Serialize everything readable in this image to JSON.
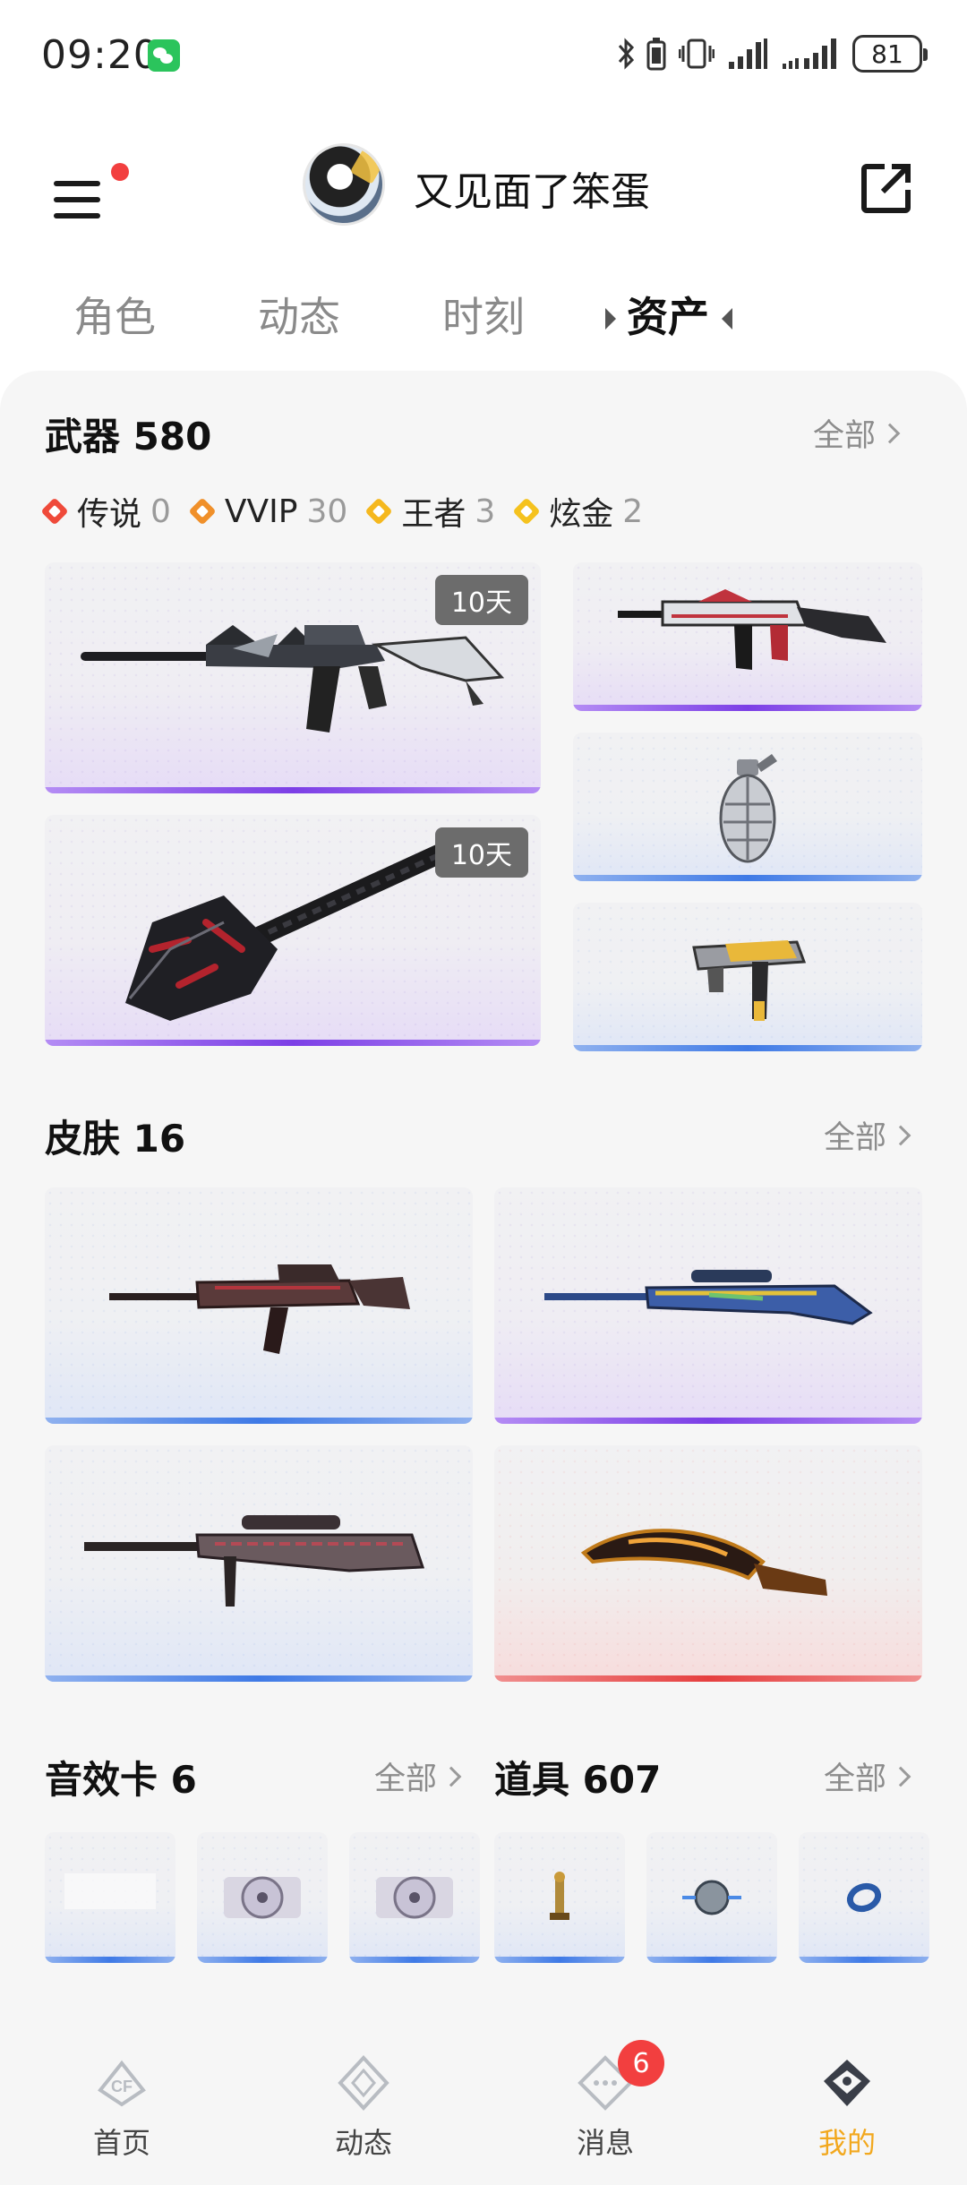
{
  "status_bar": {
    "time": "09:20",
    "battery": "81"
  },
  "header": {
    "username": "又见面了笨蛋"
  },
  "tabs": [
    {
      "label": "角色"
    },
    {
      "label": "动态"
    },
    {
      "label": "时刻"
    },
    {
      "label": "资产"
    }
  ],
  "weapons": {
    "title": "武器 580",
    "see_all": "全部",
    "rarities": [
      {
        "label": "传说",
        "count": "0",
        "color": "#ef4a3a"
      },
      {
        "label": "VVIP",
        "count": "30",
        "color": "#f0902a"
      },
      {
        "label": "王者",
        "count": "3",
        "color": "#f5b81e"
      },
      {
        "label": "炫金",
        "count": "2",
        "color": "#f5c21e"
      }
    ],
    "items": [
      {
        "name": "rifle",
        "tag": "10天",
        "rarity": "purple"
      },
      {
        "name": "shovel",
        "tag": "10天",
        "rarity": "purple"
      },
      {
        "name": "rifle-white-red",
        "rarity": "purple"
      },
      {
        "name": "grenade",
        "rarity": "blue"
      },
      {
        "name": "smg-gold",
        "rarity": "blue"
      }
    ]
  },
  "skins": {
    "title": "皮肤 16",
    "see_all": "全部",
    "items": [
      {
        "name": "rifle-red",
        "rarity": "blue"
      },
      {
        "name": "sniper-camo",
        "rarity": "purple"
      },
      {
        "name": "heavy-sniper",
        "rarity": "blue"
      },
      {
        "name": "kukri-knife",
        "rarity": "red"
      }
    ]
  },
  "sound_cards": {
    "title": "音效卡 6",
    "see_all": "全部",
    "items": [
      {
        "name": "sound-card-1"
      },
      {
        "name": "sound-card-2"
      },
      {
        "name": "sound-card-3"
      }
    ]
  },
  "props": {
    "title": "道具 607",
    "see_all": "全部",
    "items": [
      {
        "name": "trophy"
      },
      {
        "name": "medal"
      },
      {
        "name": "ring"
      }
    ]
  },
  "bottom_nav": [
    {
      "label": "首页",
      "icon": "home-icon"
    },
    {
      "label": "动态",
      "icon": "feed-icon"
    },
    {
      "label": "消息",
      "icon": "message-icon",
      "badge": "6"
    },
    {
      "label": "我的",
      "icon": "profile-icon",
      "active": true
    }
  ],
  "colors": {
    "accent": "#f2a81e",
    "badge": "#f23f3f"
  }
}
